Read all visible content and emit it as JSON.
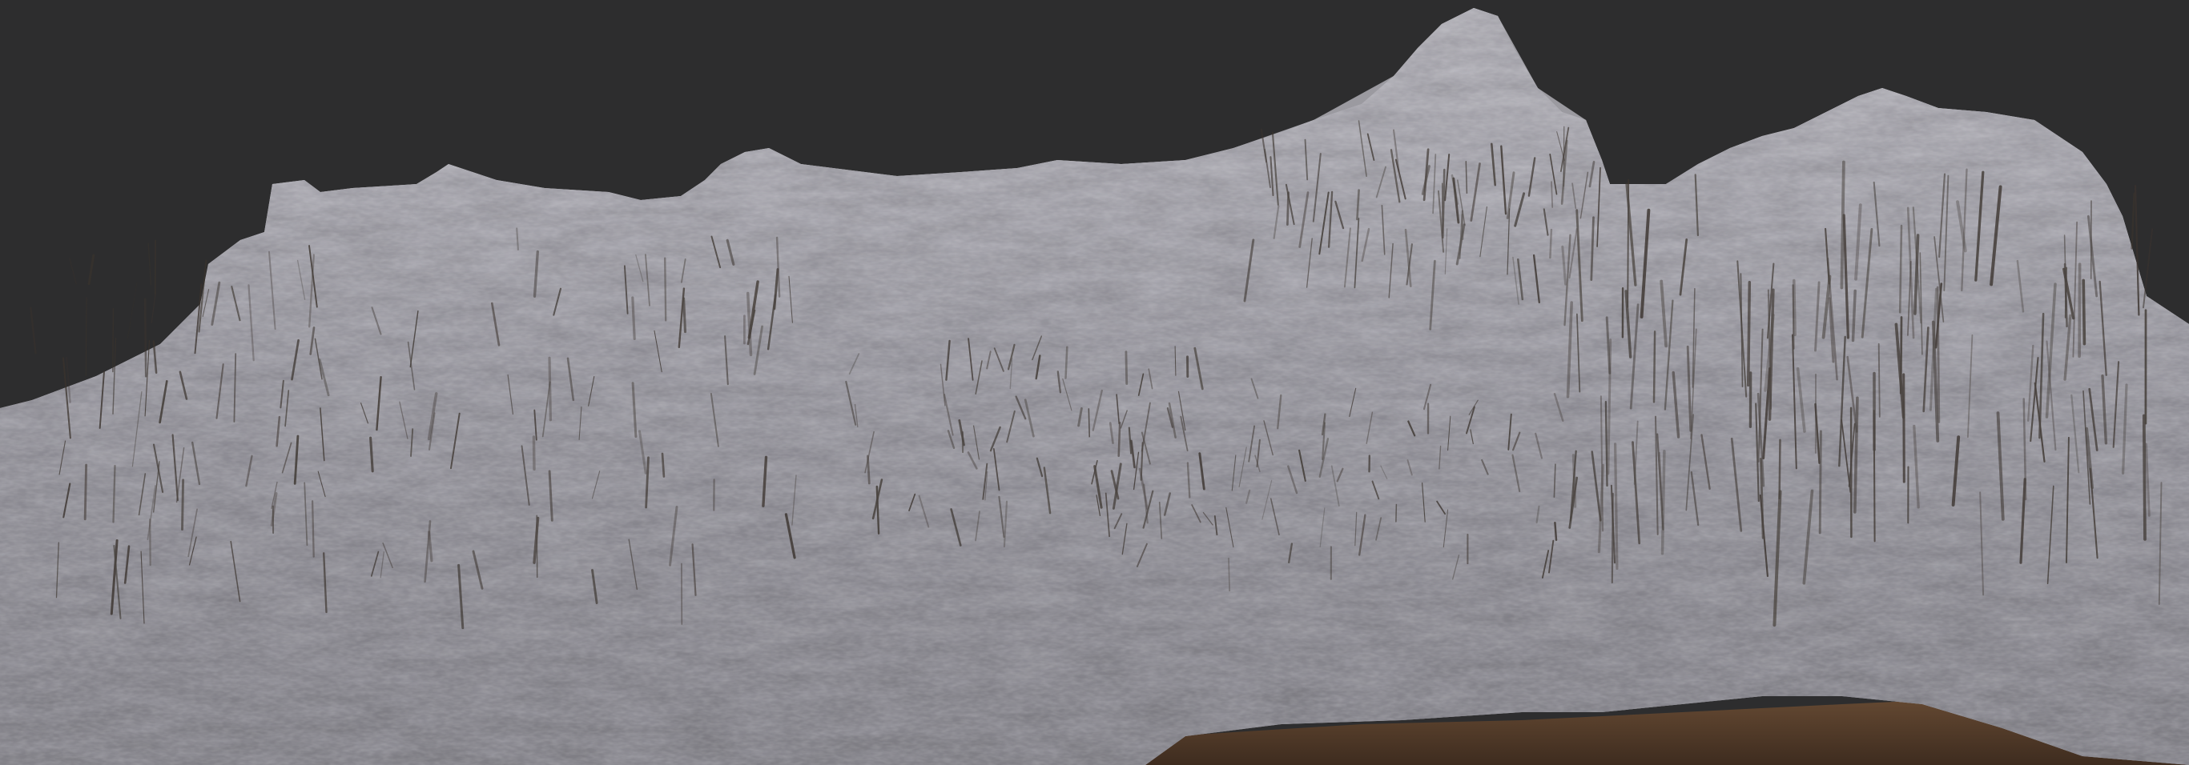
{
  "scene": {
    "kind": "3d-terrain-render",
    "colors": {
      "background": "#2d2d2e",
      "rock_light": "#c2c1c8",
      "rock_mid": "#9a99a1",
      "rock_dark": "#6f6d72",
      "crevice": "#3b342e",
      "soil": "#5a4230",
      "soil_dark": "#3e2c1f"
    }
  }
}
